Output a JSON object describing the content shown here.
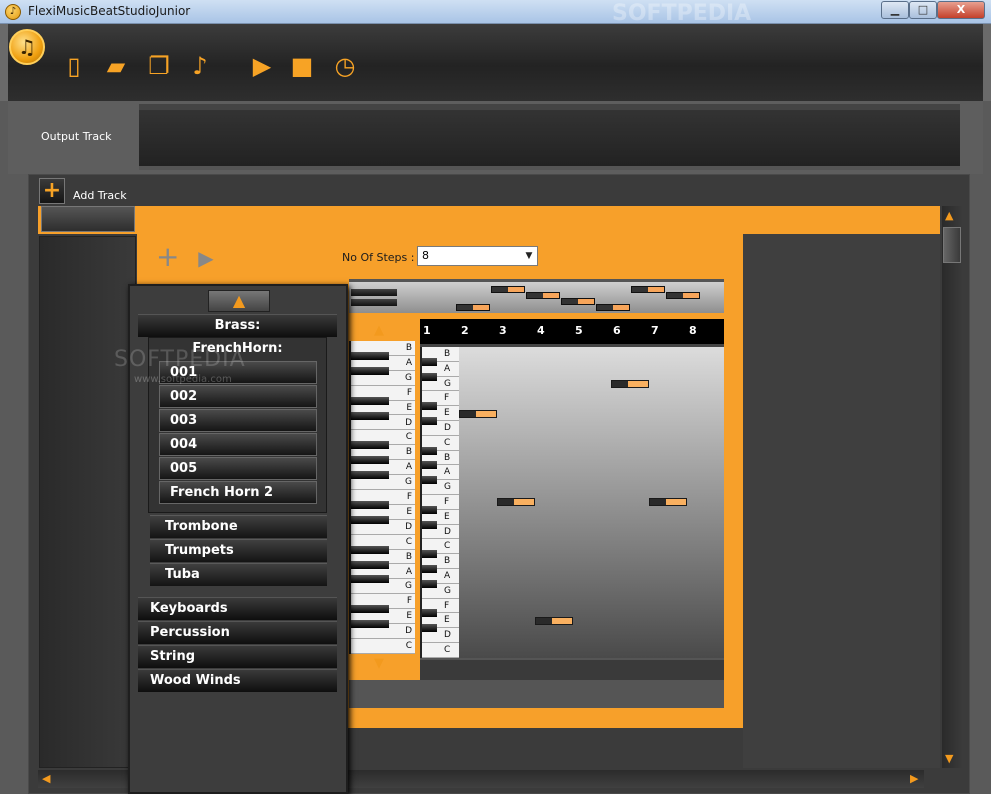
{
  "window": {
    "title": "FlexiMusicBeatStudioJunior",
    "buttons": {
      "minimize": "▁",
      "maximize": "□",
      "close": "X"
    }
  },
  "watermark": {
    "top": "SOFTPEDIA",
    "overlay": "SOFTPEDIA",
    "url": "www.softpedia.com"
  },
  "toolbar": {
    "icons": [
      "new-file-icon",
      "open-folder-icon",
      "copy-file-icon",
      "music-file-icon",
      "play-icon",
      "stop-icon",
      "clock-music-icon"
    ]
  },
  "output": {
    "label": "Output Track"
  },
  "tracks": {
    "add_label": "Add Track"
  },
  "sequencer": {
    "steps_label": "No Of Steps :",
    "steps_value": "8",
    "step_numbers": [
      "1",
      "2",
      "3",
      "4",
      "5",
      "6",
      "7",
      "8"
    ],
    "notes": [
      {
        "step": 2,
        "pitch": "G"
      },
      {
        "step": 3,
        "pitch": "A"
      },
      {
        "step": 4,
        "pitch": "G"
      },
      {
        "step": 6,
        "pitch": "B"
      },
      {
        "step": 7,
        "pitch": "A"
      }
    ],
    "piano_keys": [
      "B",
      "A",
      "G",
      "F",
      "E",
      "D",
      "C",
      "B",
      "A",
      "G",
      "F",
      "E",
      "D",
      "C",
      "B",
      "A",
      "G",
      "F",
      "E",
      "D",
      "C"
    ]
  },
  "instrument_menu": {
    "category": "Brass:",
    "subcategory": "FrenchHorn:",
    "variants": [
      "001",
      "002",
      "003",
      "004",
      "005",
      "French Horn 2"
    ],
    "brass_items": [
      "Trombone",
      "Trumpets",
      "Tuba"
    ],
    "categories": [
      "Keyboards",
      "Percussion",
      "String",
      "Wood Winds"
    ]
  },
  "colors": {
    "accent": "#f7a02a",
    "dark": "#232323"
  }
}
